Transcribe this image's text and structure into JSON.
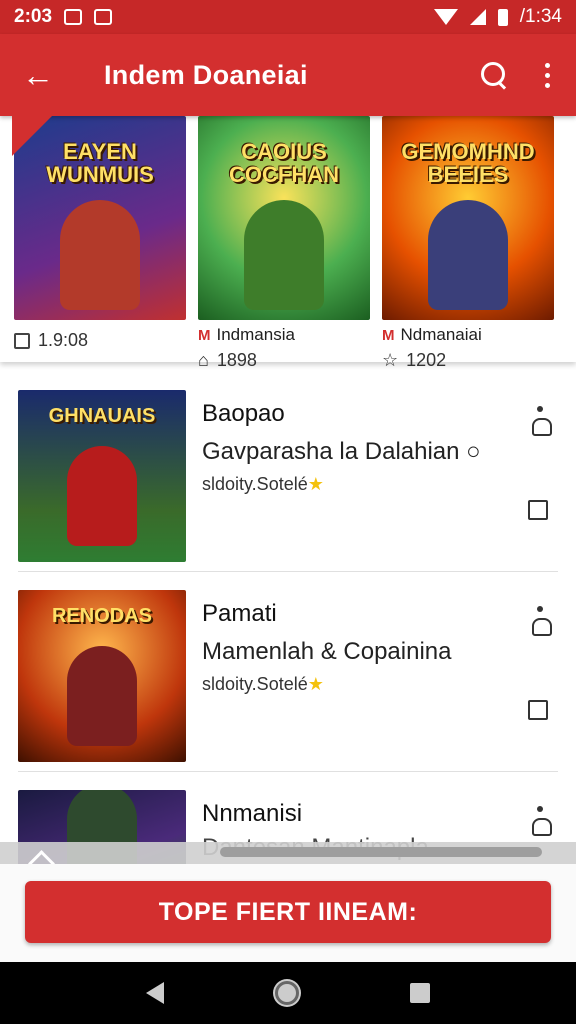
{
  "status_bar": {
    "time_left": "2:03",
    "time_right": "/1:34"
  },
  "app_bar": {
    "title": "Indem Doaneiai",
    "back_icon": "arrow-back-icon",
    "search_icon": "search-icon",
    "menu_icon": "more-vert-icon"
  },
  "featured": [
    {
      "art_text": "EAYEN WUNMUIS",
      "meta_label": "",
      "meta_value": "1.9:08",
      "bg": "linear-gradient(160deg,#1e3c8c,#6a2a8a 60%,#c03030)",
      "hero": "#b33a2a"
    },
    {
      "art_text": "CAOIUS COCFHAN",
      "meta_label": "Indmansia",
      "meta_value": "1898",
      "bg": "radial-gradient(circle at 50% 40%,#f9e25a,#4caf50 55%,#1b5e20)",
      "hero": "#3e7d2a"
    },
    {
      "art_text": "GEMOMHND BEEIES",
      "meta_label": "Ndmanaiai",
      "meta_value": "1202",
      "bg": "radial-gradient(circle at 50% 40%,#ffcc33,#e65100 55%,#6d1b00)",
      "hero": "#3a3f7a"
    }
  ],
  "list": [
    {
      "title": "Baopao",
      "subtitle": "Gavparasha la Dalahian",
      "developer": "sldoity.Sotelé",
      "art_text": "GHNAUAIS",
      "bg": "linear-gradient(180deg,#1a2a6c,#3a6a2a 70%,#2e7d32)",
      "hero": "#b71c1c"
    },
    {
      "title": "Pamati",
      "subtitle": "Mamenlah & Copainina",
      "developer": "sldoity.Sotelé",
      "art_text": "RENODAS",
      "bg": "radial-gradient(circle at 50% 35%,#ffb74d,#bf360c 60%,#3e1000)",
      "hero": "#7b1f1f"
    },
    {
      "title": "Nnmanisi",
      "subtitle": "Dantesan Mantinapla",
      "developer": "",
      "art_text": "",
      "bg": "linear-gradient(160deg,#1a1a40,#4a2a7a 60%,#2a6a2a)",
      "hero": "#2e4a2e"
    }
  ],
  "cta": {
    "label": "TOPE FIERT IINEAM:"
  },
  "colors": {
    "primary": "#d32f2f",
    "status": "#c62828"
  }
}
